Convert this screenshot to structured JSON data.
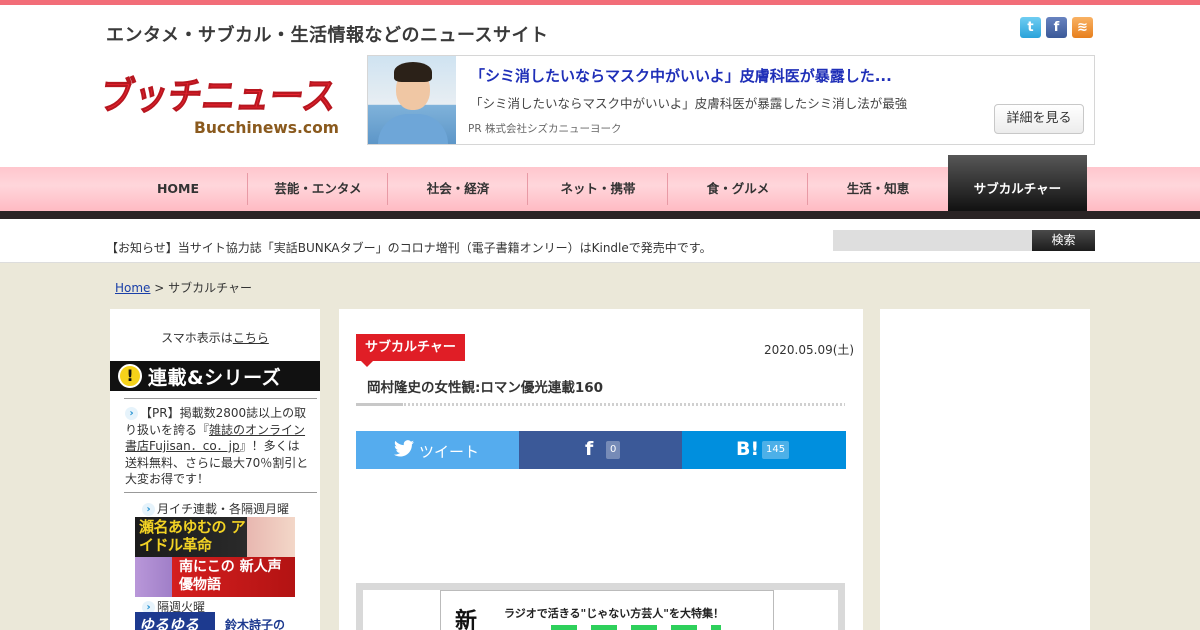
{
  "site": {
    "tagline": "エンタメ・サブカル・生活情報などのニュースサイト",
    "logo_text": "ブッチニュース",
    "logo_sub": "Bucchinews.com"
  },
  "social": {
    "twitter": "t",
    "facebook": "f",
    "rss": "≋"
  },
  "ad": {
    "title": "「シミ消したいならマスク中がいいよ」皮膚科医が暴露した...",
    "description": "「シミ消したいならマスク中がいいよ」皮膚科医が暴露したシミ消し法が最強",
    "source": "PR  株式会社シズカニューヨーク",
    "button": "詳細を見る"
  },
  "nav": {
    "items": [
      {
        "label": "HOME"
      },
      {
        "label": "芸能・エンタメ"
      },
      {
        "label": "社会・経済"
      },
      {
        "label": "ネット・携帯"
      },
      {
        "label": "食・グルメ"
      },
      {
        "label": "生活・知恵"
      },
      {
        "label": "サブカルチャー"
      }
    ],
    "active_index": 6
  },
  "notice": "【お知らせ】当サイト協力誌「実話BUNKAタブー」のコロナ増刊（電子書籍オンリー）はKindleで発売中です。",
  "search": {
    "placeholder": "",
    "button": "検索"
  },
  "breadcrumb": {
    "home": "Home",
    "separator": " > ",
    "current": "サブカルチャー"
  },
  "sidebar": {
    "sp_prefix": "スマホ表示は",
    "sp_link": "こちら",
    "series_badge": "!",
    "series_title": "連載&シリーズ",
    "pr_prefix": "【PR】掲載数2800誌以上の取り扱いを誇る『",
    "pr_link": "雑誌のオンライン書店Fujisan．co．jp",
    "pr_suffix": "』！多くは送料無料、さらに最大70％割引と大変お得です！",
    "schedule1": "月イチ連載・各隔週月曜",
    "banner1": "瀬名あゆむの アイドル革命",
    "banner2": "南にこの 新人声優物語",
    "schedule2": "隔週火曜",
    "banner3a": "ゆるゆる",
    "banner3b": "鈴木詩子の"
  },
  "article": {
    "category": "サブカルチャー",
    "date": "2020.05.09(土)",
    "title": "岡村隆史の女性観:ロマン優光連載160",
    "share": {
      "tweet_label": "ツイート",
      "facebook_count": "0",
      "hatena_count": "145"
    },
    "promo": {
      "big": "新",
      "text": "ラジオで活きる\"じゃない方芸人\"を大特集！"
    }
  },
  "colors": {
    "accent_red": "#e01e26",
    "nav_pink": "#ffc6cd",
    "twitter": "#55acee",
    "facebook": "#3b5998",
    "hatena": "#008fde"
  }
}
